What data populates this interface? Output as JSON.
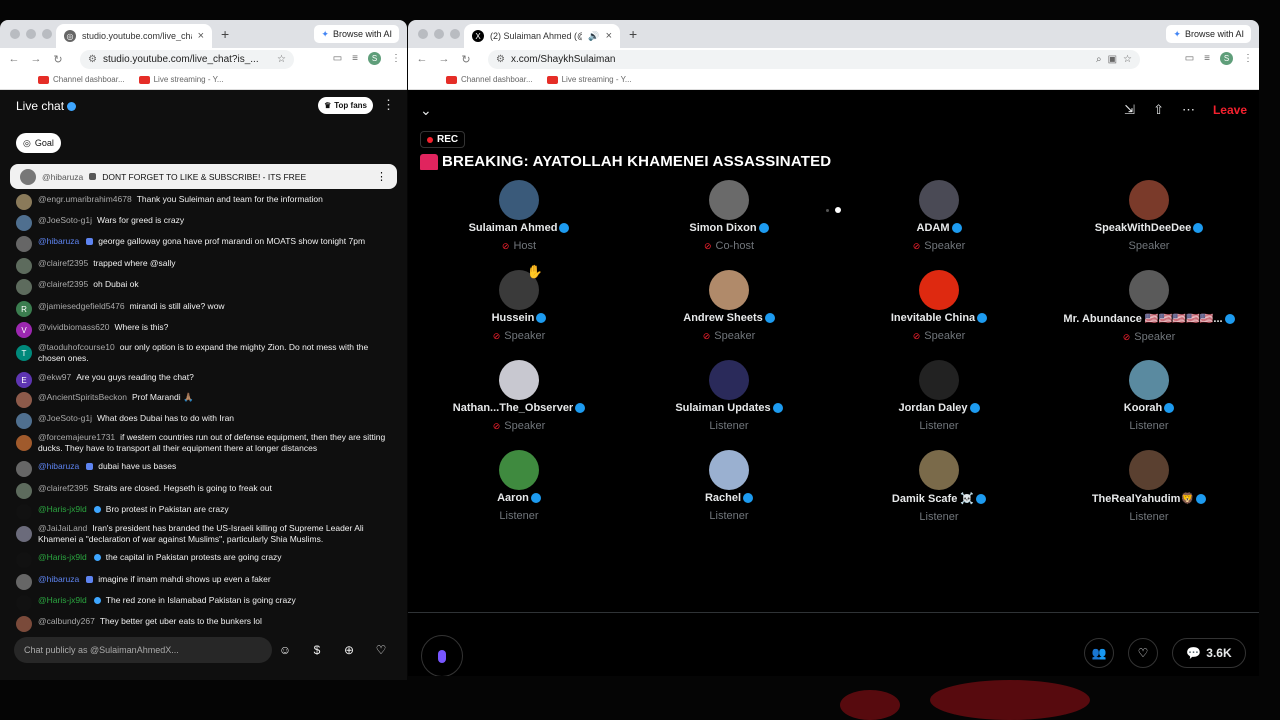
{
  "chat_window": {
    "tab_title": "studio.youtube.com/live_chat",
    "browse_ai": "Browse with AI",
    "url": "studio.youtube.com/live_chat?is_...",
    "bookmarks": [
      "Channel dashboar...",
      "Live streaming - Y..."
    ],
    "profile_initial": "S",
    "header_title": "Live chat",
    "top_fans": "Top fans",
    "goal": "Goal",
    "pinned": {
      "author": "@hibaruza",
      "text": "DONT FORGET TO LIKE & SUBSCRIBE! - ITS FREE"
    },
    "messages": [
      {
        "author": "@engr.umaribrahim4678",
        "text": "Thank you Suleiman and team for the information",
        "avatar": "",
        "color": "#8a7a5a",
        "style": ""
      },
      {
        "author": "@JoeSoto-g1j",
        "text": "Wars for greed is crazy",
        "avatar": "",
        "color": "#4f6f8f",
        "style": ""
      },
      {
        "author": "@hibaruza",
        "text": "george galloway gona have prof marandi on MOATS show tonight 7pm",
        "avatar": "",
        "color": "#666",
        "style": "mod"
      },
      {
        "author": "@clairef2395",
        "text": "trapped where @sally",
        "avatar": "",
        "color": "#5d6b5d",
        "style": ""
      },
      {
        "author": "@clairef2395",
        "text": "oh Dubai ok",
        "avatar": "",
        "color": "#5d6b5d",
        "style": ""
      },
      {
        "author": "@jamiesedgefield5476",
        "text": "mirandi is still alive? wow",
        "avatar": "R",
        "color": "#3b7d4f",
        "style": ""
      },
      {
        "author": "@vividbiomass620",
        "text": "Where is this?",
        "avatar": "V",
        "color": "#9c27b0",
        "style": ""
      },
      {
        "author": "@taoduhofcourse10",
        "text": "our only option is to expand the mighty Zion. Do not mess with the chosen ones.",
        "avatar": "T",
        "color": "#00897b",
        "style": ""
      },
      {
        "author": "@ekw97",
        "text": "Are you guys reading the chat?",
        "avatar": "E",
        "color": "#5e35b1",
        "style": ""
      },
      {
        "author": "@AncientSpiritsBeckon",
        "text": "Prof Marandi 🙏🏽",
        "avatar": "",
        "color": "#8d5a4a",
        "style": ""
      },
      {
        "author": "@JoeSoto-g1j",
        "text": "What does Dubai has to do with Iran",
        "avatar": "",
        "color": "#4f6f8f",
        "style": ""
      },
      {
        "author": "@forcemajeure1731",
        "text": "if western countries run out of defense equipment, then they are sitting ducks. They have to transport all their equipment there at longer distances",
        "avatar": "",
        "color": "#a05a2c",
        "style": ""
      },
      {
        "author": "@hibaruza",
        "text": "dubai have us bases",
        "avatar": "",
        "color": "#666",
        "style": "mod"
      },
      {
        "author": "@clairef2395",
        "text": "Straits are closed. Hegseth is going to freak out",
        "avatar": "",
        "color": "#5d6b5d",
        "style": ""
      },
      {
        "author": "@Haris-jx9ld",
        "text": "Bro protest in Pakistan are crazy",
        "avatar": "",
        "color": "#111",
        "style": "green"
      },
      {
        "author": "@JaiJaiLand",
        "text": "Iran's president has branded the US-Israeli killing of Supreme Leader Ali Khamenei a \"declaration of war against Muslims\", particularly Shia Muslims.",
        "avatar": "",
        "color": "#6b6b7b",
        "style": ""
      },
      {
        "author": "@Haris-jx9ld",
        "text": "the capital in Pakistan protests are going crazy",
        "avatar": "",
        "color": "#111",
        "style": "green"
      },
      {
        "author": "@hibaruza",
        "text": "imagine if imam mahdi shows up even a faker",
        "avatar": "",
        "color": "#666",
        "style": "mod"
      },
      {
        "author": "@Haris-jx9ld",
        "text": "The red zone in Islamabad Pakistan is going crazy",
        "avatar": "",
        "color": "#111",
        "style": "green"
      },
      {
        "author": "@calbundy267",
        "text": "They better get uber eats to the bunkers lol",
        "avatar": "",
        "color": "#7a4a3a",
        "style": ""
      }
    ],
    "input_placeholder": "Chat publicly as @SulaimanAhmedX..."
  },
  "space_window": {
    "tab_title": "(2) Sulaiman Ahmed (@S",
    "browse_ai": "Browse with AI",
    "url": "x.com/ShaykhSulaiman",
    "bookmarks": [
      "Channel dashboar...",
      "Live streaming - Y..."
    ],
    "profile_initial": "S",
    "leave": "Leave",
    "rec": "REC",
    "title": "BREAKING: AYATOLLAH KHAMENEI ASSASSINATED",
    "participants": [
      {
        "name": "Sulaiman Ahmed",
        "role": "Host",
        "muted": true,
        "color": "#3a5a7a"
      },
      {
        "name": "Simon Dixon",
        "role": "Co-host",
        "muted": true,
        "color": "#6a6a6a"
      },
      {
        "name": "ADAM",
        "role": "Speaker",
        "muted": true,
        "color": "#4a4a55"
      },
      {
        "name": "SpeakWithDeeDee",
        "role": "Speaker",
        "muted": false,
        "color": "#7a3a2a"
      },
      {
        "name": "Hussein",
        "role": "Speaker",
        "muted": true,
        "color": "#3a3a3a"
      },
      {
        "name": "Andrew Sheets",
        "role": "Speaker",
        "muted": true,
        "color": "#b08a6a"
      },
      {
        "name": "Inevitable China",
        "role": "Speaker",
        "muted": true,
        "color": "#de2910"
      },
      {
        "name": "Mr. Abundance 🇺🇸🇺🇸🇺🇸🇺🇸🇺🇸...",
        "role": "Speaker",
        "muted": true,
        "color": "#5a5a5a"
      },
      {
        "name": "Nathan...The_Observer",
        "role": "Speaker",
        "muted": true,
        "color": "#c8c8d0"
      },
      {
        "name": "Sulaiman Updates",
        "role": "Listener",
        "muted": false,
        "color": "#2a2a5a"
      },
      {
        "name": "Jordan Daley",
        "role": "Listener",
        "muted": false,
        "color": "#222"
      },
      {
        "name": "Koorah",
        "role": "Listener",
        "muted": false,
        "color": "#5a8aa0"
      },
      {
        "name": "Aaron",
        "role": "Listener",
        "muted": false,
        "color": "#3f8a3f"
      },
      {
        "name": "Rachel",
        "role": "Listener",
        "muted": false,
        "color": "#9ab0d0"
      },
      {
        "name": "Damik Scafe ☠️",
        "role": "Listener",
        "muted": false,
        "color": "#7a6a4a"
      },
      {
        "name": "TheRealYahudim🦁",
        "role": "Listener",
        "muted": false,
        "color": "#5a4030"
      }
    ],
    "listener_count": "3.6K"
  }
}
